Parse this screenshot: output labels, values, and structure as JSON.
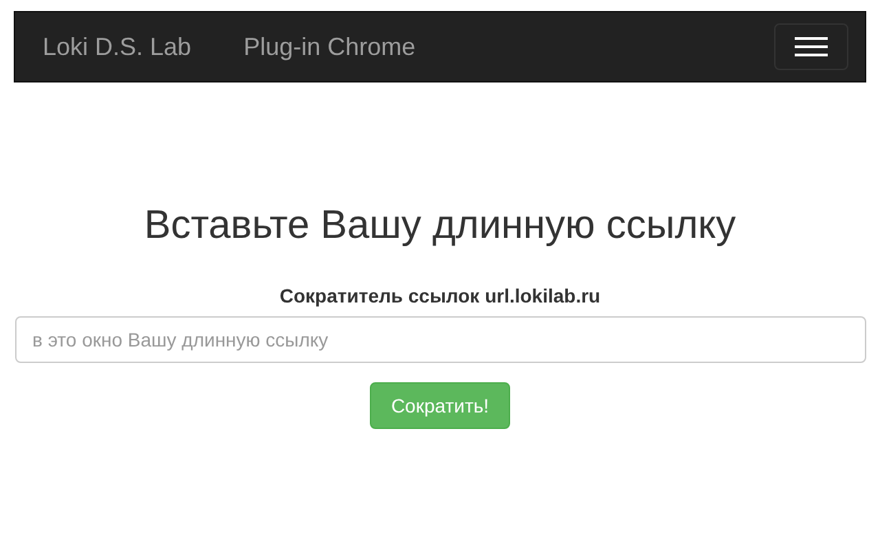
{
  "navbar": {
    "brand": "Loki D.S. Lab",
    "links": [
      "Plug-in Chrome"
    ]
  },
  "main": {
    "heading": "Вставьте Вашу длинную ссылку",
    "label": "Сократитель ссылок url.lokilab.ru",
    "url_field": {
      "placeholder": "в это окно Вашу длинную ссылку"
    },
    "submit_button": "Сократить!"
  }
}
